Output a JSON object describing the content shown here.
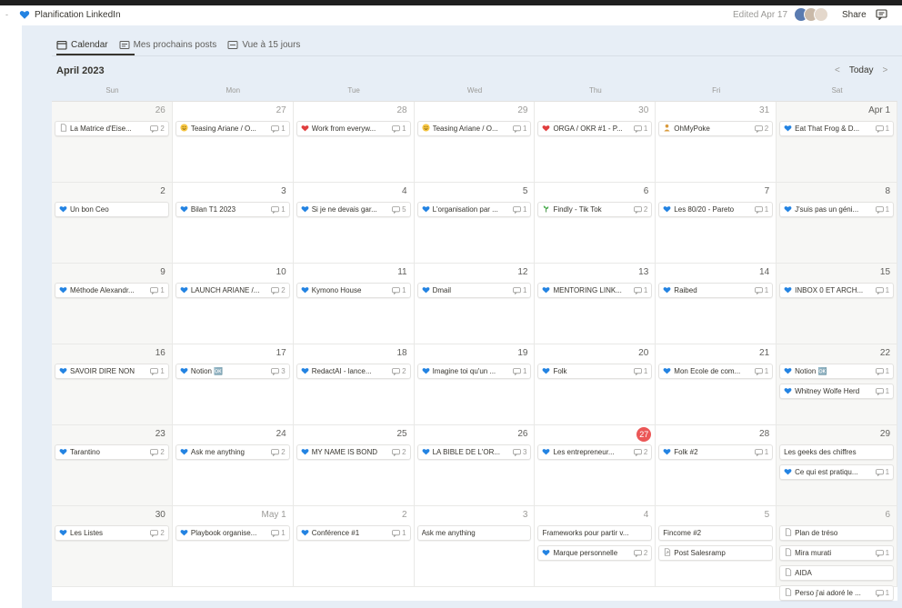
{
  "app": {
    "title": "Planification LinkedIn",
    "edited": "Edited Apr 17",
    "share_label": "Share"
  },
  "colors": {
    "blue_heart": "#2383e2",
    "red_heart": "#e03e3e",
    "today": "#eb5757",
    "background": "#e7eef6"
  },
  "tabs": [
    {
      "label": "Calendar",
      "icon": "calendar-icon",
      "active": true
    },
    {
      "label": "Mes prochains posts",
      "icon": "list-icon",
      "active": false
    },
    {
      "label": "Vue à 15 jours",
      "icon": "board-icon",
      "active": false
    }
  ],
  "calendar": {
    "month_label": "April 2023",
    "today_label": "Today",
    "weekdays": [
      "Sun",
      "Mon",
      "Tue",
      "Wed",
      "Thu",
      "Fri",
      "Sat"
    ],
    "weeks": [
      [
        {
          "day": "26",
          "current": false,
          "events": [
            {
              "icon": "doc",
              "title": "La Matrice d'Eise...",
              "comments": "2"
            }
          ]
        },
        {
          "day": "27",
          "current": false,
          "events": [
            {
              "icon": "smile",
              "title": "Teasing Ariane / O...",
              "comments": "1"
            }
          ]
        },
        {
          "day": "28",
          "current": false,
          "events": [
            {
              "icon": "red-heart",
              "title": "Work from everyw...",
              "comments": "1"
            }
          ]
        },
        {
          "day": "29",
          "current": false,
          "events": [
            {
              "icon": "smile",
              "title": "Teasing Ariane / O...",
              "comments": "1"
            }
          ]
        },
        {
          "day": "30",
          "current": false,
          "events": [
            {
              "icon": "red-heart",
              "title": "ORGA / OKR #1 - P...",
              "comments": "1"
            }
          ]
        },
        {
          "day": "31",
          "current": false,
          "events": [
            {
              "icon": "person",
              "title": "OhMyPoke",
              "comments": "2"
            }
          ]
        },
        {
          "day": "Apr 1",
          "current": true,
          "events": [
            {
              "icon": "heart",
              "title": "Eat That Frog & D...",
              "comments": "1"
            }
          ]
        }
      ],
      [
        {
          "day": "2",
          "current": true,
          "events": [
            {
              "icon": "heart",
              "title": "Un bon Ceo",
              "comments": ""
            }
          ]
        },
        {
          "day": "3",
          "current": true,
          "events": [
            {
              "icon": "heart",
              "title": "Bilan T1 2023",
              "comments": "1"
            }
          ]
        },
        {
          "day": "4",
          "current": true,
          "events": [
            {
              "icon": "heart",
              "title": "Si je ne devais gar...",
              "comments": "5"
            }
          ]
        },
        {
          "day": "5",
          "current": true,
          "events": [
            {
              "icon": "heart",
              "title": "L'organisation par ...",
              "comments": "1"
            }
          ]
        },
        {
          "day": "6",
          "current": true,
          "events": [
            {
              "icon": "plant",
              "title": "Findly - Tik Tok",
              "comments": "2"
            }
          ]
        },
        {
          "day": "7",
          "current": true,
          "events": [
            {
              "icon": "heart",
              "title": "Les 80/20 - Pareto",
              "comments": "1"
            }
          ]
        },
        {
          "day": "8",
          "current": true,
          "events": [
            {
              "icon": "heart",
              "title": "J'suis pas un géni...",
              "comments": "1"
            }
          ]
        }
      ],
      [
        {
          "day": "9",
          "current": true,
          "events": [
            {
              "icon": "heart",
              "title": "Méthode Alexandr...",
              "comments": "1"
            }
          ]
        },
        {
          "day": "10",
          "current": true,
          "events": [
            {
              "icon": "heart",
              "title": "LAUNCH ARIANE /...",
              "comments": "2"
            }
          ]
        },
        {
          "day": "11",
          "current": true,
          "events": [
            {
              "icon": "heart",
              "title": "Kymono House",
              "comments": "1"
            }
          ]
        },
        {
          "day": "12",
          "current": true,
          "events": [
            {
              "icon": "heart",
              "title": "Dmail",
              "comments": "1"
            }
          ]
        },
        {
          "day": "13",
          "current": true,
          "events": [
            {
              "icon": "heart",
              "title": "MENTORING LINK...",
              "comments": "1"
            }
          ]
        },
        {
          "day": "14",
          "current": true,
          "events": [
            {
              "icon": "heart",
              "title": "Raibed",
              "comments": "1"
            }
          ]
        },
        {
          "day": "15",
          "current": true,
          "events": [
            {
              "icon": "heart",
              "title": "INBOX 0 ET ARCH...",
              "comments": "1"
            }
          ]
        }
      ],
      [
        {
          "day": "16",
          "current": true,
          "events": [
            {
              "icon": "heart",
              "title": "SAVOIR DIRE NON",
              "comments": "1"
            }
          ]
        },
        {
          "day": "17",
          "current": true,
          "events": [
            {
              "icon": "heart",
              "title": "Notion 🆗",
              "comments": "3"
            }
          ]
        },
        {
          "day": "18",
          "current": true,
          "events": [
            {
              "icon": "heart",
              "title": "RedactAI - lance...",
              "comments": "2"
            }
          ]
        },
        {
          "day": "19",
          "current": true,
          "events": [
            {
              "icon": "heart",
              "title": "Imagine toi qu'un ...",
              "comments": "1"
            }
          ]
        },
        {
          "day": "20",
          "current": true,
          "events": [
            {
              "icon": "heart",
              "title": "Folk",
              "comments": "1"
            }
          ]
        },
        {
          "day": "21",
          "current": true,
          "events": [
            {
              "icon": "heart",
              "title": "Mon Ecole de com...",
              "comments": "1"
            }
          ]
        },
        {
          "day": "22",
          "current": true,
          "events": [
            {
              "icon": "heart",
              "title": "Notion 🆗",
              "comments": "1"
            },
            {
              "icon": "heart",
              "title": "Whitney Wolfe Herd",
              "comments": "1"
            }
          ]
        }
      ],
      [
        {
          "day": "23",
          "current": true,
          "events": [
            {
              "icon": "heart",
              "title": "Tarantino",
              "comments": "2"
            }
          ]
        },
        {
          "day": "24",
          "current": true,
          "events": [
            {
              "icon": "heart",
              "title": "Ask me anything",
              "comments": "2"
            }
          ]
        },
        {
          "day": "25",
          "current": true,
          "events": [
            {
              "icon": "heart",
              "title": "MY NAME IS BOND",
              "comments": "2"
            }
          ]
        },
        {
          "day": "26",
          "current": true,
          "events": [
            {
              "icon": "heart",
              "title": "LA BIBLE DE L'OR...",
              "comments": "3"
            }
          ]
        },
        {
          "day": "27",
          "current": true,
          "today": true,
          "events": [
            {
              "icon": "heart",
              "title": "Les entrepreneur...",
              "comments": "2"
            }
          ]
        },
        {
          "day": "28",
          "current": true,
          "events": [
            {
              "icon": "heart",
              "title": "Folk #2",
              "comments": "1"
            }
          ]
        },
        {
          "day": "29",
          "current": true,
          "events": [
            {
              "icon": "",
              "title": "Les geeks des chiffres",
              "comments": ""
            },
            {
              "icon": "heart",
              "title": "Ce qui est pratiqu...",
              "comments": "1"
            }
          ]
        }
      ],
      [
        {
          "day": "30",
          "current": true,
          "events": [
            {
              "icon": "heart",
              "title": "Les Listes",
              "comments": "2"
            }
          ]
        },
        {
          "day": "May 1",
          "current": false,
          "events": [
            {
              "icon": "heart",
              "title": "Playbook organise...",
              "comments": "1"
            }
          ]
        },
        {
          "day": "2",
          "current": false,
          "events": [
            {
              "icon": "heart",
              "title": "Conférence #1",
              "comments": "1"
            }
          ]
        },
        {
          "day": "3",
          "current": false,
          "events": [
            {
              "icon": "",
              "title": "Ask me anything",
              "comments": ""
            }
          ]
        },
        {
          "day": "4",
          "current": false,
          "events": [
            {
              "icon": "",
              "title": "Frameworks pour partir v...",
              "comments": ""
            },
            {
              "icon": "heart",
              "title": "Marque personnelle",
              "comments": "2"
            }
          ]
        },
        {
          "day": "5",
          "current": false,
          "events": [
            {
              "icon": "",
              "title": "Fincome #2",
              "comments": ""
            },
            {
              "icon": "arrow",
              "title": "Post Salesramp",
              "comments": ""
            }
          ]
        },
        {
          "day": "6",
          "current": false,
          "events": [
            {
              "icon": "doc",
              "title": "Plan de tréso",
              "comments": ""
            },
            {
              "icon": "doc",
              "title": "Mira murati",
              "comments": "1"
            },
            {
              "icon": "doc",
              "title": "AIDA",
              "comments": ""
            },
            {
              "icon": "doc",
              "title": "Perso j'ai adoré le ...",
              "comments": "1"
            }
          ]
        }
      ]
    ]
  }
}
